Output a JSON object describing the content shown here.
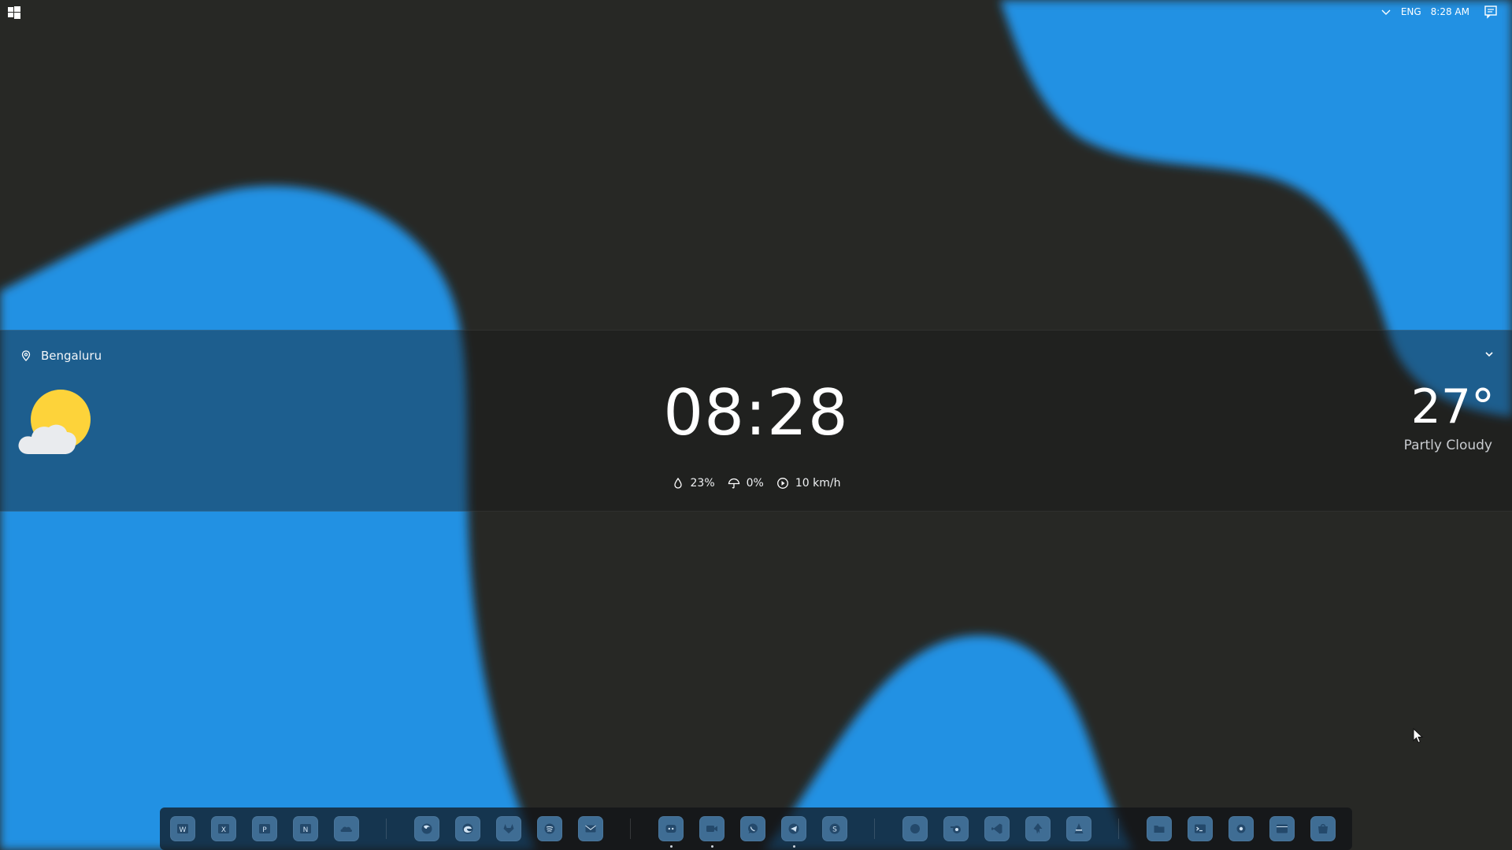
{
  "colors": {
    "background": "#272825",
    "blob": "#2391e3",
    "sun": "#fdd33a",
    "cloud": "#e9ebee",
    "dock_icon": "#3f6d94"
  },
  "tray": {
    "language": "ENG",
    "time": "8:28 AM",
    "icons": [
      "chevron-down-icon",
      "notification-center-icon"
    ]
  },
  "weather": {
    "location": "Bengaluru",
    "clock": "08:28",
    "temperature": "27°",
    "condition": "Partly Cloudy",
    "humidity": "23%",
    "precipitation": "0%",
    "wind": "10 km/h",
    "icon": "partly-cloudy-icon"
  },
  "dock": {
    "groups": [
      {
        "apps": [
          "word-icon",
          "excel-icon",
          "powerpoint-icon",
          "onenote-icon",
          "onedrive-icon"
        ]
      },
      {
        "apps": [
          "firefox-icon",
          "edge-icon",
          "gitlab-icon",
          "spotify-icon",
          "mail-icon"
        ]
      },
      {
        "apps": [
          "discord-icon",
          "zoom-icon",
          "whatsapp-icon",
          "telegram-icon",
          "skype-icon"
        ]
      },
      {
        "apps": [
          "app-blob-icon",
          "blender-icon",
          "vscode-icon",
          "inkscape-icon",
          "vlc-icon"
        ]
      },
      {
        "apps": [
          "file-explorer-icon",
          "terminal-icon",
          "settings-icon",
          "window-app-icon",
          "store-icon"
        ]
      }
    ],
    "running": [
      "discord-icon",
      "zoom-icon",
      "telegram-icon"
    ]
  }
}
